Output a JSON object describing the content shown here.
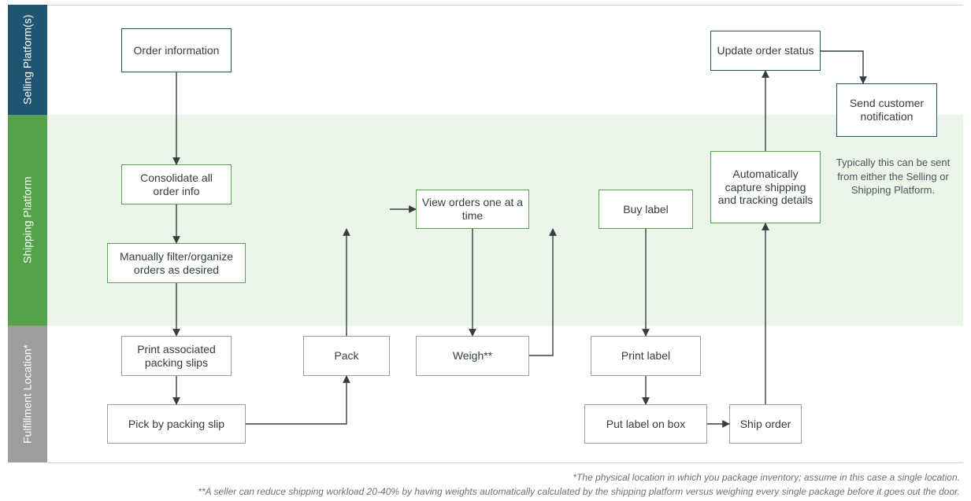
{
  "lanes": {
    "selling": "Selling\nPlatform(s)",
    "shipping": "Shipping\nPlatform",
    "fulfillment": "Fulfillment\nLocation*"
  },
  "nodes": {
    "order_info": "Order information",
    "consolidate": "Consolidate all order info",
    "filter": "Manually filter/organize orders as desired",
    "print_slips": "Print associated packing slips",
    "pick": "Pick by packing slip",
    "pack": "Pack",
    "view_orders": "View orders one at a time",
    "weigh": "Weigh**",
    "buy_label": "Buy label",
    "print_label": "Print label",
    "put_label": "Put label on box",
    "ship": "Ship order",
    "capture": "Automatically capture shipping and tracking details",
    "update": "Update order status",
    "notify": "Send customer notification"
  },
  "note": "Typically this can be sent from either the Selling or Shipping Platform.",
  "footnotes": {
    "f1": "*The physical location in which you package inventory; assume in this case a single location.",
    "f2": "**A seller can reduce shipping workload 20-40% by having weights automatically calculated by the shipping platform versus weighing every single package before it goes out the door."
  },
  "chart_data": {
    "type": "flowchart",
    "lanes": [
      {
        "id": "selling",
        "label": "Selling Platform(s)"
      },
      {
        "id": "shipping",
        "label": "Shipping Platform"
      },
      {
        "id": "fulfillment",
        "label": "Fulfillment Location*"
      }
    ],
    "nodes": [
      {
        "id": "order_info",
        "lane": "selling",
        "label": "Order information"
      },
      {
        "id": "consolidate",
        "lane": "shipping",
        "label": "Consolidate all order info"
      },
      {
        "id": "filter",
        "lane": "shipping",
        "label": "Manually filter/organize orders as desired"
      },
      {
        "id": "print_slips",
        "lane": "fulfillment",
        "label": "Print associated packing slips"
      },
      {
        "id": "pick",
        "lane": "fulfillment",
        "label": "Pick by packing slip"
      },
      {
        "id": "pack",
        "lane": "fulfillment",
        "label": "Pack"
      },
      {
        "id": "view_orders",
        "lane": "shipping",
        "label": "View orders one at a time"
      },
      {
        "id": "weigh",
        "lane": "fulfillment",
        "label": "Weigh**"
      },
      {
        "id": "buy_label",
        "lane": "shipping",
        "label": "Buy label"
      },
      {
        "id": "print_label",
        "lane": "fulfillment",
        "label": "Print label"
      },
      {
        "id": "put_label",
        "lane": "fulfillment",
        "label": "Put label on box"
      },
      {
        "id": "ship",
        "lane": "fulfillment",
        "label": "Ship order"
      },
      {
        "id": "capture",
        "lane": "shipping",
        "label": "Automatically capture shipping and tracking details"
      },
      {
        "id": "update",
        "lane": "selling",
        "label": "Update order status"
      },
      {
        "id": "notify",
        "lane": "selling",
        "label": "Send customer notification"
      }
    ],
    "edges": [
      [
        "order_info",
        "consolidate"
      ],
      [
        "consolidate",
        "filter"
      ],
      [
        "filter",
        "print_slips"
      ],
      [
        "print_slips",
        "pick"
      ],
      [
        "pick",
        "pack"
      ],
      [
        "pack",
        "view_orders"
      ],
      [
        "view_orders",
        "weigh"
      ],
      [
        "weigh",
        "buy_label"
      ],
      [
        "buy_label",
        "print_label"
      ],
      [
        "print_label",
        "put_label"
      ],
      [
        "put_label",
        "ship"
      ],
      [
        "ship",
        "capture"
      ],
      [
        "capture",
        "update"
      ],
      [
        "update",
        "notify"
      ]
    ],
    "annotations": [
      {
        "target": "notify",
        "text": "Typically this can be sent from either the Selling or Shipping Platform."
      }
    ],
    "footnotes": [
      "*The physical location in which you package inventory; assume in this case a single location.",
      "**A seller can reduce shipping workload 20-40% by having weights automatically calculated by the shipping platform versus weighing every single package before it goes out the door."
    ]
  }
}
